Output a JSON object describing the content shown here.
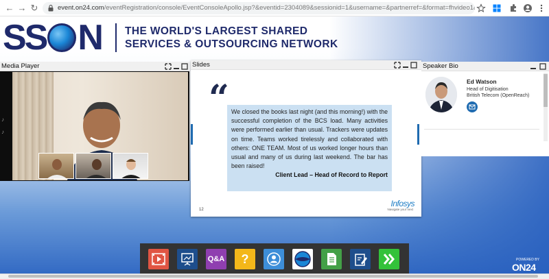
{
  "browser": {
    "url_host": "event.on24.com",
    "url_path": "/eventRegistration/console/EventConsoleApollo.jsp?&eventid=2304089&sessionid=1&username=&partnerref=&format=fhvideo1&mobile=&flashs..."
  },
  "brand": {
    "logo_text_left": "SS",
    "logo_text_right": "N",
    "tagline_line1": "THE WORLD'S LARGEST SHARED",
    "tagline_line2": "SERVICES & OUTSOURCING NETWORK"
  },
  "media_player": {
    "title": "Media Player"
  },
  "slides": {
    "title": "Slides",
    "quote_text": "We closed the books last night (and this morning!) with the successful completion of the BCS load.  Many activities were performed earlier than usual. Trackers were updates on time. Teams worked tirelessly and collaborated with others: ONE TEAM.  Most of us worked longer hours than usual and many of us during last weekend. The bar has been raised!",
    "quote_author": "Client Lead – Head of Record to Report",
    "slide_number": "12",
    "sponsor_logo": "Infosys",
    "sponsor_tagline": "Navigate your next"
  },
  "speaker_bio": {
    "title": "Speaker Bio",
    "name": "Ed Watson",
    "role": "Head of Digitisation",
    "company": "British Telecom (OpenReach)"
  },
  "toolbar": {
    "qa_label": "Q&A",
    "help_label": "?"
  },
  "footer": {
    "powered_by": "POWERED BY",
    "brand": "ON24"
  },
  "colors": {
    "brand_navy": "#1f2a6b",
    "accent_blue": "#1f6bb0",
    "toolbar_bg": "#333333",
    "quote_bg": "#cbe0f2"
  }
}
